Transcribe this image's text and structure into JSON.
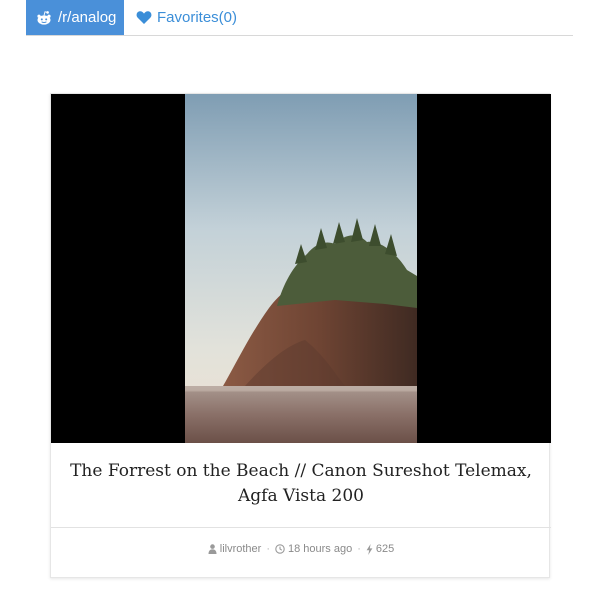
{
  "header": {
    "subreddit_label": "/r/analog",
    "subreddit_icon": "reddit-icon",
    "favorites_label": "Favorites(0)",
    "favorites_icon": "heart-icon",
    "accent_color": "#4a90d9"
  },
  "post": {
    "title": "The Forrest on the Beach // Canon Sureshot Telemax, Agfa Vista 200",
    "author": "lilvrother",
    "time_ago": "18 hours ago",
    "score": "625",
    "author_icon": "user-icon",
    "time_icon": "clock-icon",
    "score_icon": "bolt-icon",
    "separator": "·"
  }
}
